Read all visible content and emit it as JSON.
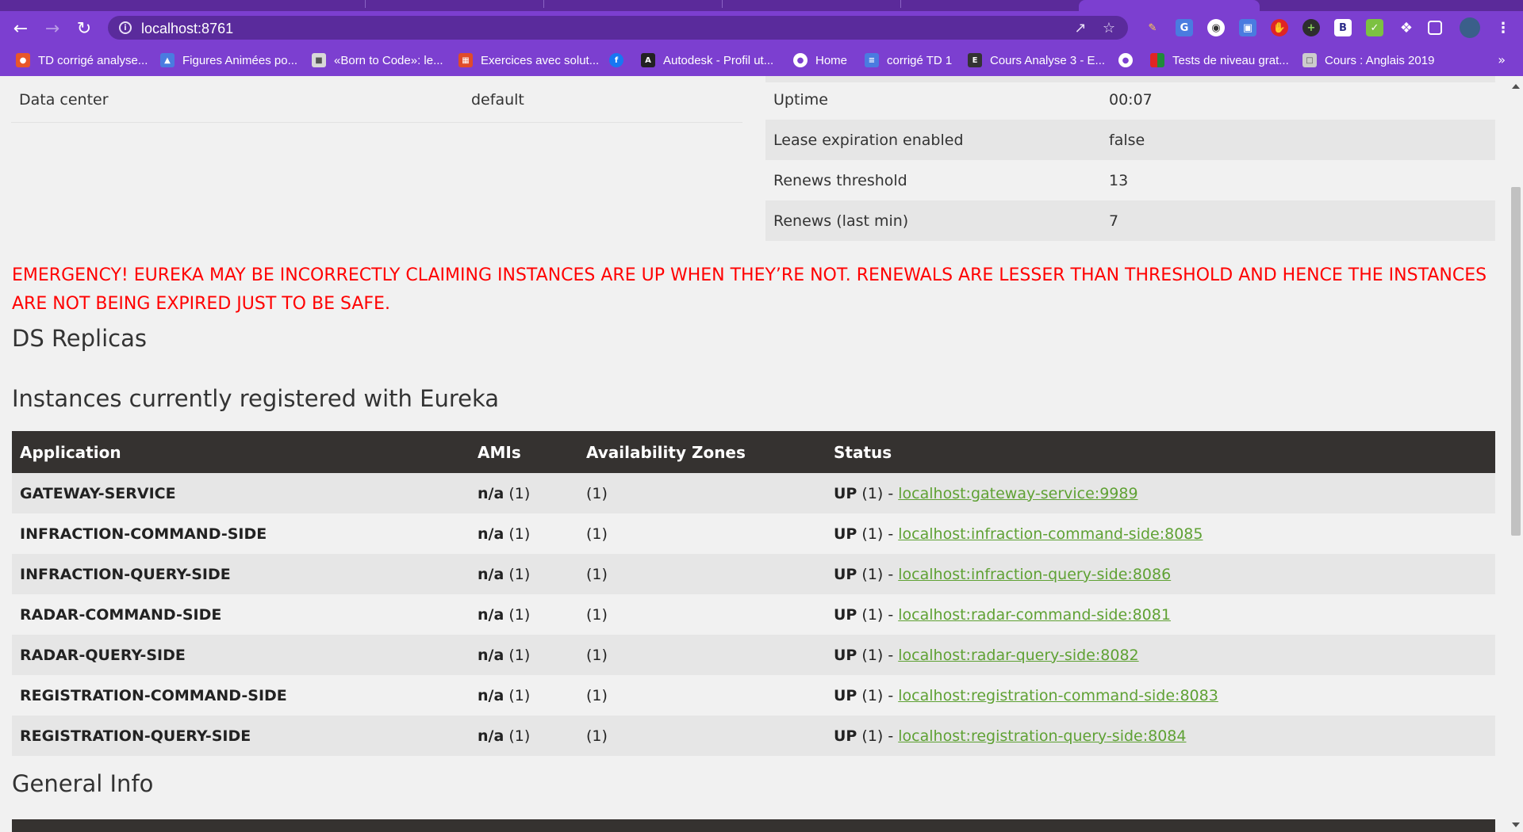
{
  "browser": {
    "url": "localhost:8761",
    "bookmarks": [
      {
        "label": "TD corrigé analyse...",
        "color": "#e8562a",
        "glyph": "td"
      },
      {
        "label": "Figures Animées po...",
        "color": "#4a7be0",
        "glyph": "fa"
      },
      {
        "label": "«Born to Code»: le...",
        "color": "#d8d8d8",
        "glyph": "bc"
      },
      {
        "label": "Exercices avec solut...",
        "color": "#e04b2a",
        "glyph": "ex"
      },
      {
        "label": "",
        "color": "#1877f2",
        "glyph": "f"
      },
      {
        "label": "Autodesk - Profil ut...",
        "color": "#222222",
        "glyph": "A"
      },
      {
        "label": "Home",
        "color": "#ffffff",
        "glyph": "globe"
      },
      {
        "label": "corrigé TD 1",
        "color": "#4a7be0",
        "glyph": "doc"
      },
      {
        "label": "Cours Analyse 3 - E...",
        "color": "#333333",
        "glyph": "Ex"
      },
      {
        "label": "",
        "color": "#ffffff",
        "glyph": "globe"
      },
      {
        "label": "Tests de niveau grat...",
        "color": "#f4c20d",
        "glyph": "grid"
      },
      {
        "label": "Cours : Anglais 2019",
        "color": "#cccccc",
        "glyph": "page"
      }
    ]
  },
  "left_info": {
    "rows": [
      {
        "key": "Data center",
        "value": "default"
      }
    ]
  },
  "right_info": {
    "rows": [
      {
        "key": "Uptime",
        "value": "00:07"
      },
      {
        "key": "Lease expiration enabled",
        "value": "false"
      },
      {
        "key": "Renews threshold",
        "value": "13"
      },
      {
        "key": "Renews (last min)",
        "value": "7"
      }
    ]
  },
  "emergency_text": "EMERGENCY! EUREKA MAY BE INCORRECTLY CLAIMING INSTANCES ARE UP WHEN THEY’RE NOT. RENEWALS ARE LESSER THAN THRESHOLD AND HENCE THE INSTANCES ARE NOT BEING EXPIRED JUST TO BE SAFE.",
  "ds_replicas_title": "DS Replicas",
  "instances_title": "Instances currently registered with Eureka",
  "instances_table": {
    "headers": [
      "Application",
      "AMIs",
      "Availability Zones",
      "Status"
    ],
    "rows": [
      {
        "application": "GATEWAY-SERVICE",
        "amis_label": "n/a",
        "amis_count": "(1)",
        "zones": "(1)",
        "status": "UP",
        "status_count": "(1) -",
        "link": "localhost:gateway-service:9989"
      },
      {
        "application": "INFRACTION-COMMAND-SIDE",
        "amis_label": "n/a",
        "amis_count": "(1)",
        "zones": "(1)",
        "status": "UP",
        "status_count": "(1) -",
        "link": "localhost:infraction-command-side:8085"
      },
      {
        "application": "INFRACTION-QUERY-SIDE",
        "amis_label": "n/a",
        "amis_count": "(1)",
        "zones": "(1)",
        "status": "UP",
        "status_count": "(1) -",
        "link": "localhost:infraction-query-side:8086"
      },
      {
        "application": "RADAR-COMMAND-SIDE",
        "amis_label": "n/a",
        "amis_count": "(1)",
        "zones": "(1)",
        "status": "UP",
        "status_count": "(1) -",
        "link": "localhost:radar-command-side:8081"
      },
      {
        "application": "RADAR-QUERY-SIDE",
        "amis_label": "n/a",
        "amis_count": "(1)",
        "zones": "(1)",
        "status": "UP",
        "status_count": "(1) -",
        "link": "localhost:radar-query-side:8082"
      },
      {
        "application": "REGISTRATION-COMMAND-SIDE",
        "amis_label": "n/a",
        "amis_count": "(1)",
        "zones": "(1)",
        "status": "UP",
        "status_count": "(1) -",
        "link": "localhost:registration-command-side:8083"
      },
      {
        "application": "REGISTRATION-QUERY-SIDE",
        "amis_label": "n/a",
        "amis_count": "(1)",
        "zones": "(1)",
        "status": "UP",
        "status_count": "(1) -",
        "link": "localhost:registration-query-side:8084"
      }
    ]
  },
  "general_info_title": "General Info",
  "colors": {
    "browser_accent": "#7c3fd0",
    "emergency": "#ff0000",
    "table_header": "#353230",
    "link": "#5fa134"
  }
}
